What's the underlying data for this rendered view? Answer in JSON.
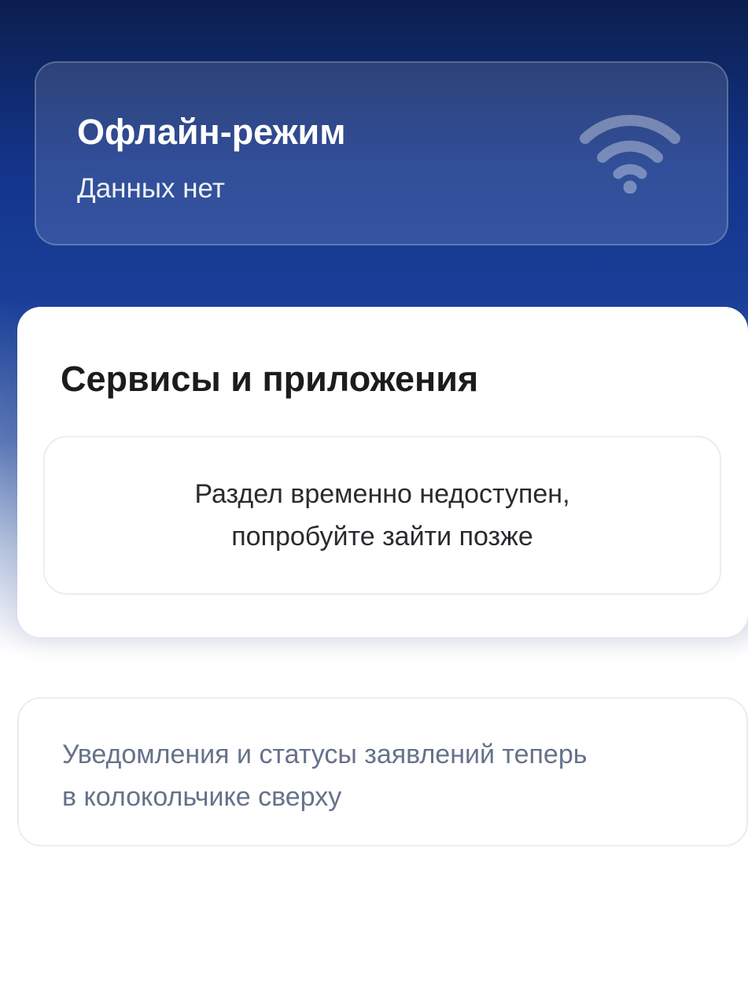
{
  "offline_card": {
    "title": "Офлайн-режим",
    "subtitle": "Данных нет",
    "icon": "wifi-icon"
  },
  "services": {
    "title": "Сервисы и приложения",
    "message_line1": "Раздел временно недоступен,",
    "message_line2": "попробуйте зайти позже"
  },
  "notice": {
    "line1": "Уведомления и статусы заявлений теперь",
    "line2": "в колокольчике сверху"
  },
  "colors": {
    "header_dark": "#0b1f4e",
    "header_blue": "#1a3f98",
    "notice_text": "#66728a"
  }
}
